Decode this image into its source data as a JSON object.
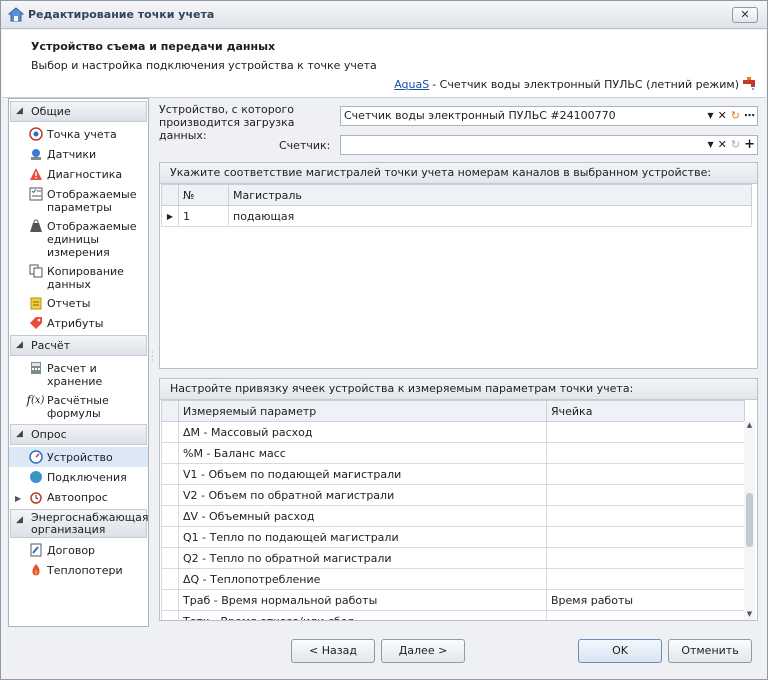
{
  "window": {
    "title": "Редактирование точки учета",
    "close": "✕"
  },
  "header": {
    "title": "Устройство съема и передачи данных",
    "subtitle": "Выбор и настройка подключения устройства к точке учета",
    "link": "AquaS",
    "link_suffix": " - Счетчик воды электронный ПУЛЬС (летний режим)"
  },
  "sidebar": {
    "groups": [
      {
        "label": "Общие",
        "items": [
          "Точка учета",
          "Датчики",
          "Диагностика",
          "Отображаемые параметры",
          "Отображаемые единицы измерения",
          "Копирование данных",
          "Отчеты",
          "Атрибуты"
        ]
      },
      {
        "label": "Расчёт",
        "items": [
          "Расчет и хранение",
          "Расчётные формулы"
        ]
      },
      {
        "label": "Опрос",
        "items": [
          "Устройство",
          "Подключения",
          "Автоопрос"
        ]
      },
      {
        "label": "Энергоснабжающая организация",
        "items": [
          "Договор",
          "Теплопотери"
        ]
      }
    ]
  },
  "device": {
    "label": "Устройство, с которого производится загрузка данных:",
    "value": "Счетчик воды электронный ПУЛЬС #24100770"
  },
  "counter": {
    "label": "Счетчик:",
    "value": ""
  },
  "channels": {
    "title": "Укажите соответствие магистралей точки учета номерам каналов в выбранном устройстве:",
    "columns": [
      "№",
      "Магистраль"
    ],
    "rows": [
      [
        "1",
        "подающая"
      ]
    ]
  },
  "bindings": {
    "title": "Настройте привязку ячеек устройства к измеряемым параметрам точки учета:",
    "columns": [
      "Измеряемый параметр",
      "Ячейка"
    ],
    "rows": [
      [
        "ΔM - Массовый расход",
        ""
      ],
      [
        "%M - Баланс масс",
        ""
      ],
      [
        "V1 - Объем по подающей магистрали",
        ""
      ],
      [
        "V2 - Объем по обратной магистрали",
        ""
      ],
      [
        "ΔV - Объемный расход",
        ""
      ],
      [
        "Q1 - Тепло по подающей магистрали",
        ""
      ],
      [
        "Q2 - Тепло по обратной магистрали",
        ""
      ],
      [
        "ΔQ - Теплопотребление",
        ""
      ],
      [
        "Траб - Время нормальной работы",
        "Время работы"
      ],
      [
        "Тотк - Время отказа/или сбоя",
        ""
      ]
    ]
  },
  "footer": {
    "back": "< Назад",
    "next": "Далее >",
    "ok": "OK",
    "cancel": "Отменить"
  },
  "colors": {
    "accent": "#1a4fa3",
    "selected": "#dde8f6"
  }
}
